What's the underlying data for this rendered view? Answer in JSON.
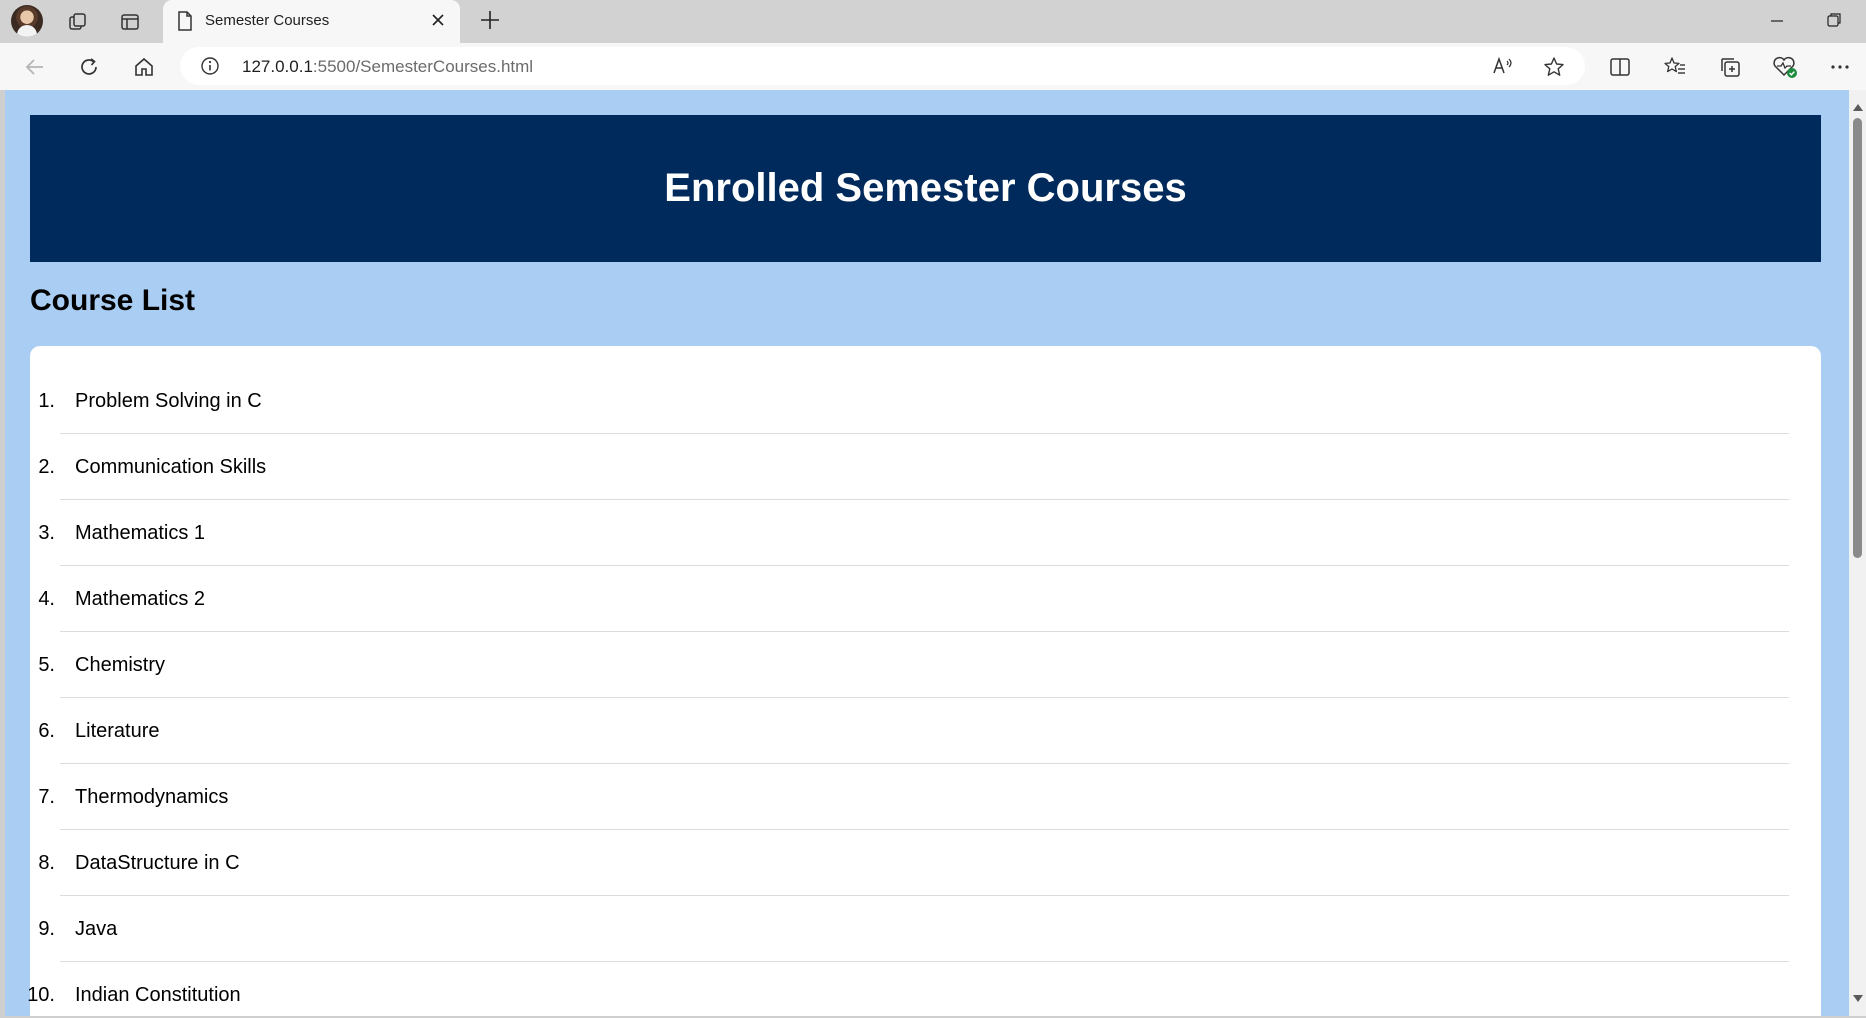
{
  "browser": {
    "tab_title": "Semester Courses",
    "url_host": "127.0.0.1",
    "url_path": ":5500/SemesterCourses.html"
  },
  "page": {
    "heading": "Enrolled Semester Courses",
    "section_title": "Course List",
    "courses": [
      {
        "num": "1.",
        "name": "Problem Solving in C"
      },
      {
        "num": "2.",
        "name": "Communication Skills"
      },
      {
        "num": "3.",
        "name": "Mathematics 1"
      },
      {
        "num": "4.",
        "name": "Mathematics 2"
      },
      {
        "num": "5.",
        "name": "Chemistry"
      },
      {
        "num": "6.",
        "name": "Literature"
      },
      {
        "num": "7.",
        "name": "Thermodynamics"
      },
      {
        "num": "8.",
        "name": "DataStructure in C"
      },
      {
        "num": "9.",
        "name": "Java"
      },
      {
        "num": "10.",
        "name": "Indian Constitution"
      }
    ]
  },
  "colors": {
    "page_background": "#a9cdf3",
    "header_background": "#002a5c",
    "card_background": "#ffffff"
  },
  "icons": [
    "profile-avatar",
    "workspaces-icon",
    "vertical-tabs-icon",
    "page-icon",
    "close-icon",
    "new-tab-icon",
    "minimize-icon",
    "restore-icon",
    "back-icon",
    "refresh-icon",
    "home-icon",
    "info-icon",
    "read-aloud-icon",
    "favorite-star-icon",
    "split-screen-icon",
    "favorites-icon",
    "collections-icon",
    "browser-essentials-icon",
    "more-icon"
  ]
}
